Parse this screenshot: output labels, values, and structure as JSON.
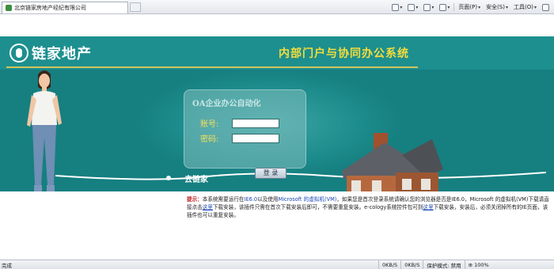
{
  "browser": {
    "tab_title": "北京链家房地产经纪有限公司",
    "commands": [
      "页面(P)",
      "安全(S)",
      "工具(O)"
    ],
    "dropdown_glyph": "▾"
  },
  "banner": {
    "logo_text": "链家地产",
    "system_title": "内部门户与协同办公系统",
    "tagline": "去链家"
  },
  "login": {
    "panel_title": "OA企业办公自动化",
    "account_label": "账号:",
    "password_label": "密码:",
    "account_value": "",
    "password_value": "",
    "submit_label": "登 录"
  },
  "notice": {
    "prefix": "提示：",
    "seg1": "本系统需要运行在",
    "ie": "IE6.0",
    "seg2": "以及使用",
    "ms": "Microsoft 的虚拟机(VM)",
    "seg3": "，如果您是首次登录系统请确认您的浏览器是否是IE6.0，Microsoft 的虚拟机(VM)下载请直接点击",
    "link1": "这里",
    "seg4": "下载安装，该插件只需在首次下载安装后即可，不需要重复安装。e-cology系统控件包可到",
    "link2": "这里",
    "seg5": "下载安装，安装后，必须关闭掉所有的IE页面，该插件也可以重复安装。"
  },
  "status": {
    "left": "完成",
    "cell1": "0KB/S",
    "cell2": "0KB/S",
    "mode": "保护模式: 禁用",
    "zoom": "100%"
  }
}
